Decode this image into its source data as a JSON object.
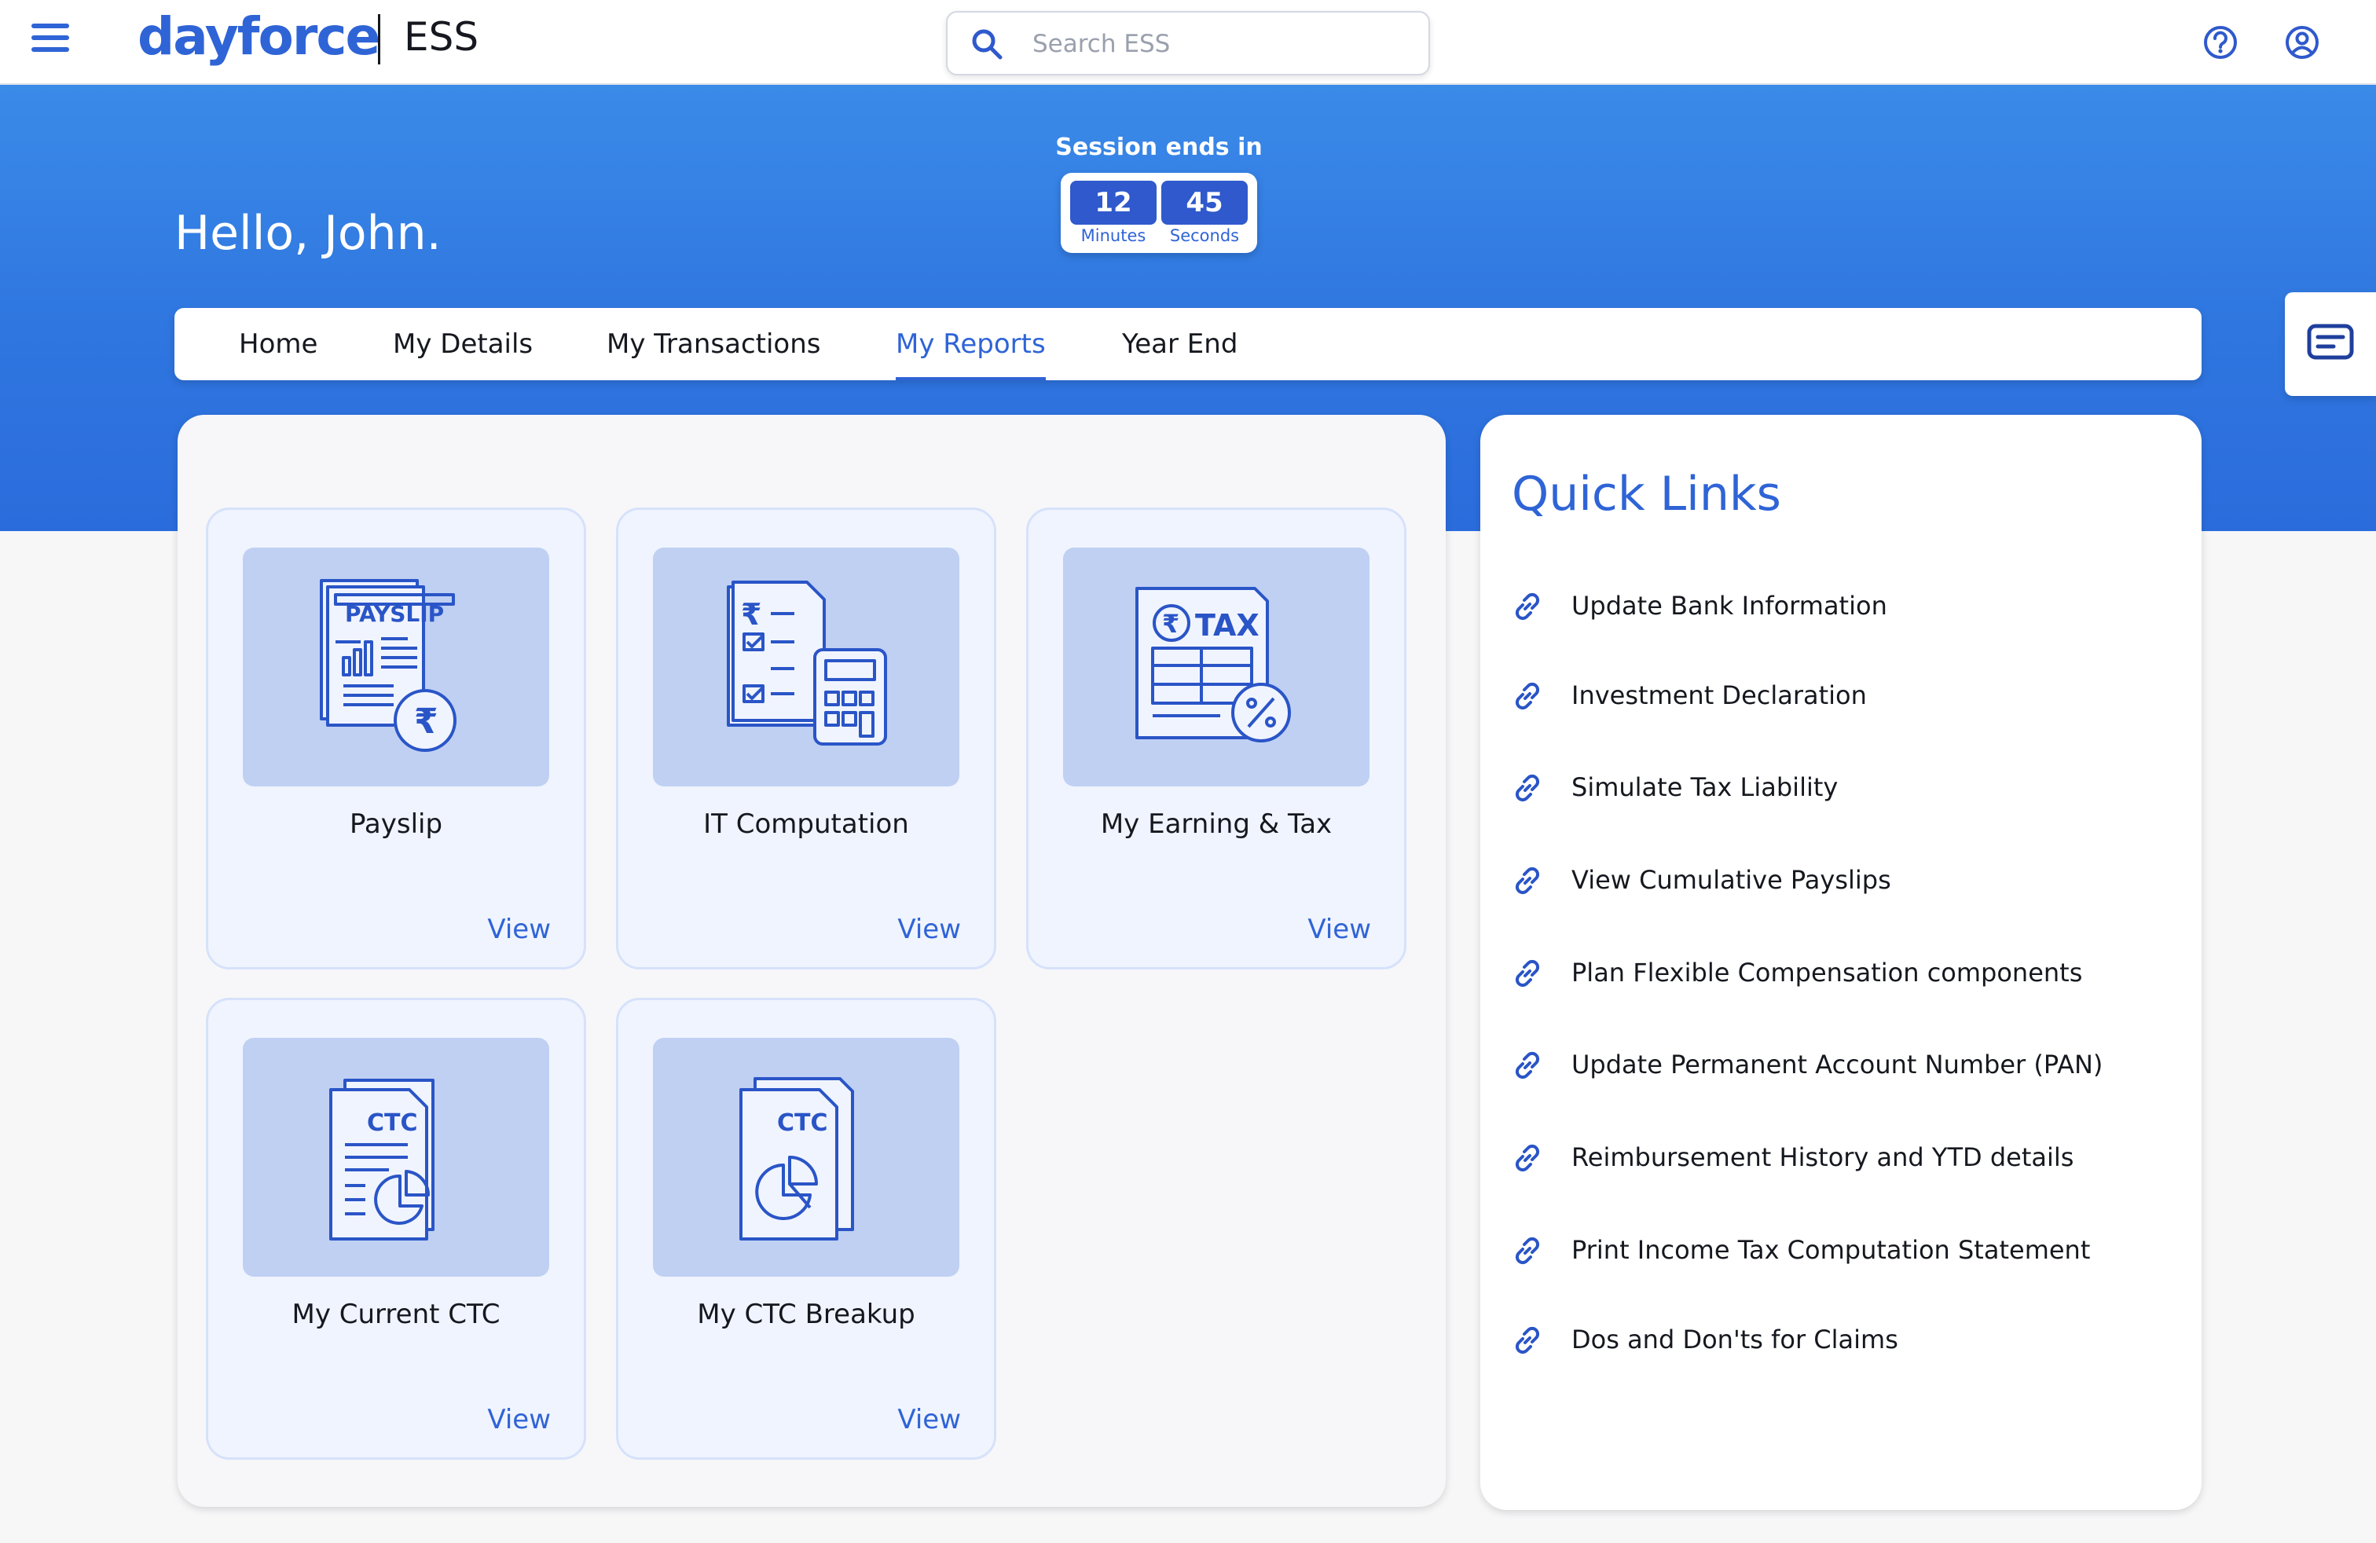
{
  "header": {
    "brand": "dayforce",
    "app_name": "ESS",
    "search_placeholder": "Search ESS"
  },
  "hero": {
    "greeting": "Hello, John.",
    "session": {
      "label": "Session ends in",
      "minutes": "12",
      "minutes_label": "Minutes",
      "seconds": "45",
      "seconds_label": "Seconds"
    }
  },
  "tabs": [
    {
      "label": "Home"
    },
    {
      "label": "My Details"
    },
    {
      "label": "My Transactions"
    },
    {
      "label": "My Reports",
      "active": true
    },
    {
      "label": "Year End"
    }
  ],
  "reports": [
    {
      "title": "Payslip",
      "view": "View",
      "art_text": "PAYSLIP",
      "icon": "payslip-icon"
    },
    {
      "title": "IT Computation",
      "view": "View",
      "icon": "it-computation-icon"
    },
    {
      "title": "My Earning & Tax",
      "view": "View",
      "art_text": "TAX",
      "icon": "earning-tax-icon"
    },
    {
      "title": "My Current CTC",
      "view": "View",
      "art_text": "CTC",
      "icon": "current-ctc-icon"
    },
    {
      "title": "My CTC Breakup",
      "view": "View",
      "art_text": "CTC",
      "icon": "ctc-breakup-icon"
    }
  ],
  "quick_links": {
    "title": "Quick Links",
    "items": [
      "Update Bank Information",
      "Investment Declaration",
      "Simulate Tax Liability",
      "View Cumulative Payslips",
      "Plan Flexible Compensation components",
      "Update Permanent Account Number (PAN)",
      "Reimbursement History and YTD details",
      "Print Income Tax Computation Statement",
      "Dos and Don'ts for Claims"
    ]
  },
  "colors": {
    "brand": "#2f64d6",
    "hero_top": "#3a8ae8",
    "hero_bottom": "#2b6cdc",
    "card_bg": "#f0f4fe",
    "card_art_bg": "#bfd0f3"
  }
}
